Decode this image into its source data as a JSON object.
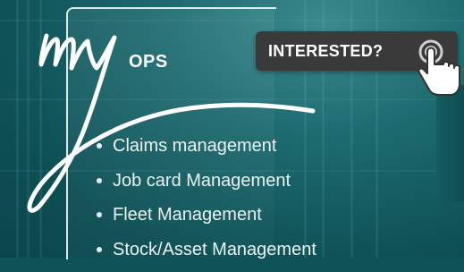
{
  "logo": {
    "script_text": "my",
    "word": "OPS"
  },
  "cta": {
    "label": "INTERESTED?",
    "icon": "tap-pointer-icon"
  },
  "features": [
    {
      "label": "Claims management"
    },
    {
      "label": "Job card Management"
    },
    {
      "label": "Fleet Management"
    },
    {
      "label": "Stock/Asset Management"
    }
  ],
  "colors": {
    "background": "#0f5358",
    "cta_background": "#3a3a3a",
    "text": "#ffffff"
  }
}
